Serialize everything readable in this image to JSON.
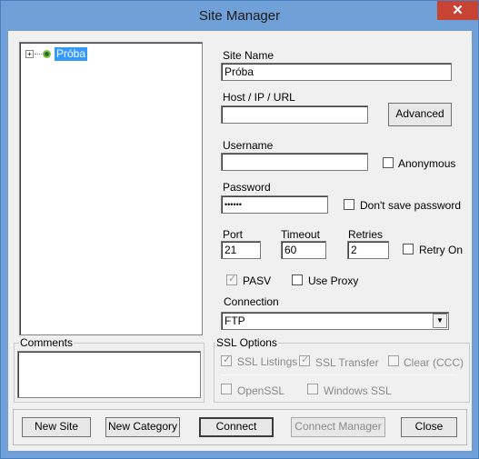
{
  "window": {
    "title": "Site Manager",
    "close_glyph": "✕"
  },
  "tree": {
    "items": [
      {
        "label": "Próba",
        "expander": "⊞"
      }
    ]
  },
  "site_name": {
    "label": "Site Name",
    "value": "Próba"
  },
  "host": {
    "label": "Host / IP / URL",
    "value": ""
  },
  "advanced_button": "Advanced",
  "username": {
    "label": "Username",
    "value": ""
  },
  "anonymous": {
    "label": "Anonymous",
    "checked": false
  },
  "password": {
    "label": "Password",
    "value": "••••••"
  },
  "dont_save_password": {
    "label": "Don't save password",
    "checked": false
  },
  "port": {
    "label": "Port",
    "value": "21"
  },
  "timeout": {
    "label": "Timeout",
    "value": "60"
  },
  "retries": {
    "label": "Retries",
    "value": "2"
  },
  "retry_on": {
    "label": "Retry On",
    "checked": false
  },
  "pasv": {
    "label": "PASV",
    "checked": true,
    "disabled": true
  },
  "use_proxy": {
    "label": "Use Proxy",
    "checked": false
  },
  "connection": {
    "label": "Connection",
    "value": "FTP"
  },
  "comments": {
    "label": "Comments",
    "value": ""
  },
  "ssl": {
    "label": "SSL Options",
    "ssl_listings": {
      "label": "SSL Listings",
      "checked": true
    },
    "ssl_transfer": {
      "label": "SSL Transfer",
      "checked": true
    },
    "clear_ccc": {
      "label": "Clear (CCC)",
      "checked": false
    },
    "openssl": {
      "label": "OpenSSL",
      "checked": false
    },
    "windows_ssl": {
      "label": "Windows SSL",
      "checked": false
    }
  },
  "buttons": {
    "new_site": "New Site",
    "new_category": "New Category",
    "connect": "Connect",
    "connect_manager": "Connect Manager",
    "close": "Close"
  },
  "icons": {
    "check": "✓",
    "dropdown": "▼"
  },
  "colors": {
    "titlebar": "#6fa1d8",
    "close": "#c74434",
    "selection": "#3399ff"
  }
}
